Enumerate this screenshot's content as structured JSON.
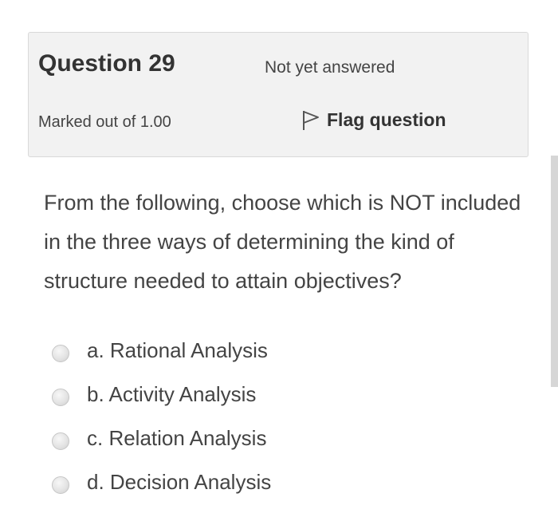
{
  "question": {
    "title": "Question 29",
    "state": "Not yet answered",
    "grade": "Marked out of 1.00",
    "flag_label": "Flag question",
    "flag_icon": "flag-icon",
    "text": "From the following, choose which is NOT included in the three ways of determining the kind of structure needed to attain objectives?"
  },
  "answers": [
    {
      "label": "a. Rational Analysis",
      "selected": false
    },
    {
      "label": "b. Activity Analysis",
      "selected": false
    },
    {
      "label": "c. Relation Analysis",
      "selected": false
    },
    {
      "label": "d. Decision Analysis",
      "selected": false
    }
  ]
}
